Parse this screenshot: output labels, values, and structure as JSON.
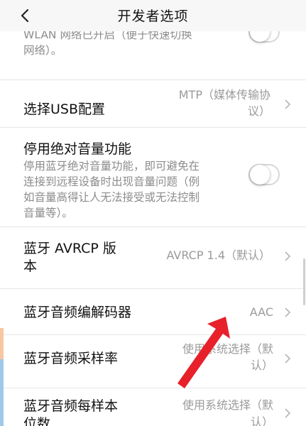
{
  "header": {
    "title": "开发者选项",
    "back_icon": "chevron-left-icon"
  },
  "items": [
    {
      "summary_line1": "WLAN 网络已开启（便于快速切换",
      "summary_line2": "网络）。",
      "toggle_on": false
    },
    {
      "title": "选择USB配置",
      "value_line1": "MTP（媒体传输协",
      "value_line2": "议）"
    },
    {
      "title": "停用绝对音量功能",
      "summary_line1": "停用蓝牙绝对音量功能，即可避免在",
      "summary_line2": "连接到远程设备时出现音量问题（例",
      "summary_line3": "如音量高得让人无法接受或无法控制",
      "summary_line4": "音量等）。",
      "toggle_on": false
    },
    {
      "title_line1": "蓝牙 AVRCP 版",
      "title_line2": "本",
      "value": "AVRCP 1.4（默认）"
    },
    {
      "title": "蓝牙音频编解码器",
      "value": "AAC"
    },
    {
      "title": "蓝牙音频采样率",
      "value_line1": "使用系统选择（默",
      "value_line2": "认）"
    },
    {
      "title_line1": "蓝牙音频每样本",
      "title_line2": "位数",
      "value_line1": "使用系统选择（默",
      "value_line2": "认）"
    }
  ],
  "colors": {
    "annotation_arrow": "#e8202a",
    "edge_strip_top": "#f7c7a2",
    "edge_strip_bottom": "#9fc9e8"
  }
}
